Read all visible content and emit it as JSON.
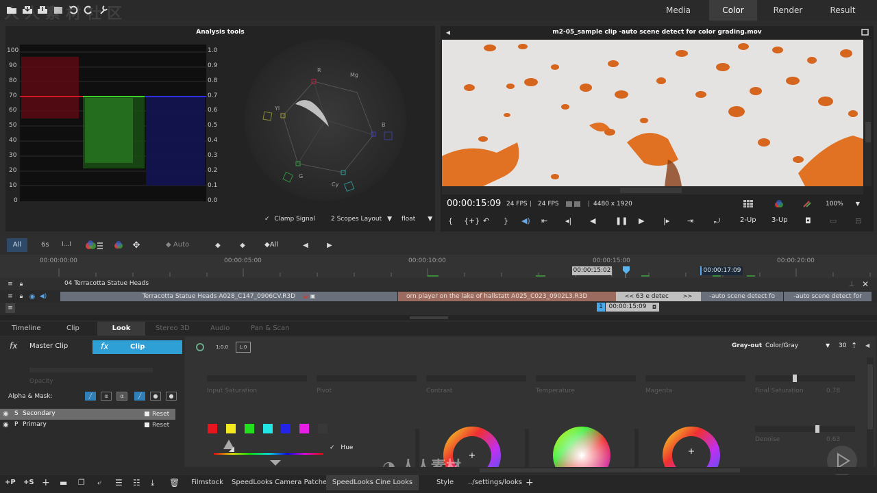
{
  "top_tabs": [
    "Media",
    "Color",
    "Render",
    "Result"
  ],
  "active_top_tab": "Color",
  "analysis": {
    "title": "Analysis tools",
    "parade_left_axis": [
      "100",
      "90",
      "80",
      "70",
      "60",
      "50",
      "40",
      "30",
      "20",
      "10",
      "0"
    ],
    "parade_right_axis": [
      "1.0",
      "0.9",
      "0.8",
      "0.7",
      "0.6",
      "0.5",
      "0.4",
      "0.3",
      "0.2",
      "0.1",
      "0.0"
    ],
    "vectorscope_labels": [
      "R",
      "Mg",
      "B",
      "Cy",
      "G",
      "Yl"
    ],
    "clamp_signal": "Clamp Signal",
    "layout": "2 Scopes Layout",
    "format": "float"
  },
  "viewer": {
    "title": "m2-05_sample clip -auto scene detect for color grading.mov",
    "timecode": "00:00:15:09",
    "fps1": "24 FPS",
    "fps2": "24 FPS",
    "resolution": "4480 x 1920",
    "zoom": "100%",
    "twoup": "2-Up",
    "threeup": "3-Up"
  },
  "timeline_toolbar": {
    "all": "All",
    "six_s": "6s",
    "dots": "I...I",
    "auto": "Auto",
    "all2": "All"
  },
  "ruler": {
    "ticks": [
      "00:00:00:00",
      "00:00:05:00",
      "00:00:10:00",
      "00:00:15:00",
      "00:00:20:00"
    ],
    "marker_in": "00:00:15:02",
    "marker_out": "00:00:17:09"
  },
  "tracks": {
    "track1_name": "04 Terracotta Statue Heads",
    "clip1": "Terracotta Statue Heads A028_C147_0906CV.R3D",
    "clip2": "orn player on the lake of hallstatt  A025_C023_0902L3.R3D",
    "clip3_num": "63",
    "clip3_text": "e detec",
    "clip4": "-auto scene detect fo",
    "clip5": "-auto scene detect for",
    "playhead_num": "1",
    "playhead_tc": "00:00:15:09"
  },
  "bottom_tabs": [
    "Timeline",
    "Clip",
    "Look",
    "Stereo 3D",
    "Audio",
    "Pan & Scan"
  ],
  "active_bottom_tab": "Look",
  "left_panel": {
    "master_clip": "Master Clip",
    "clip": "Clip",
    "opacity": "Opacity",
    "alpha_mask": "Alpha & Mask:",
    "layers": [
      {
        "key": "S",
        "name": "Secondary",
        "action": "Reset"
      },
      {
        "key": "P",
        "name": "Primary",
        "action": "Reset"
      }
    ]
  },
  "look_panel": {
    "grayout_label": "Gray-out",
    "grayout_value": "Color/Gray",
    "grayout_num": "30",
    "params": [
      "Input Saturation",
      "Pivot",
      "Contrast",
      "Temperature",
      "Magenta",
      "Final Saturation"
    ],
    "final_saturation_value": "0.78",
    "denoise": "Denoise",
    "denoise_value": "0.63",
    "hue": "Hue",
    "swatch_colors": [
      "#e8141e",
      "#f2ea1e",
      "#22e01e",
      "#22e6e6",
      "#2424e6",
      "#e61ee6"
    ]
  },
  "footer": {
    "plus_p": "+P",
    "plus_s": "+S",
    "tabs": [
      "Filmstock",
      "SpeedLooks Camera Patches",
      "SpeedLooks Cine Looks",
      "Style",
      "../settings/looks"
    ]
  }
}
